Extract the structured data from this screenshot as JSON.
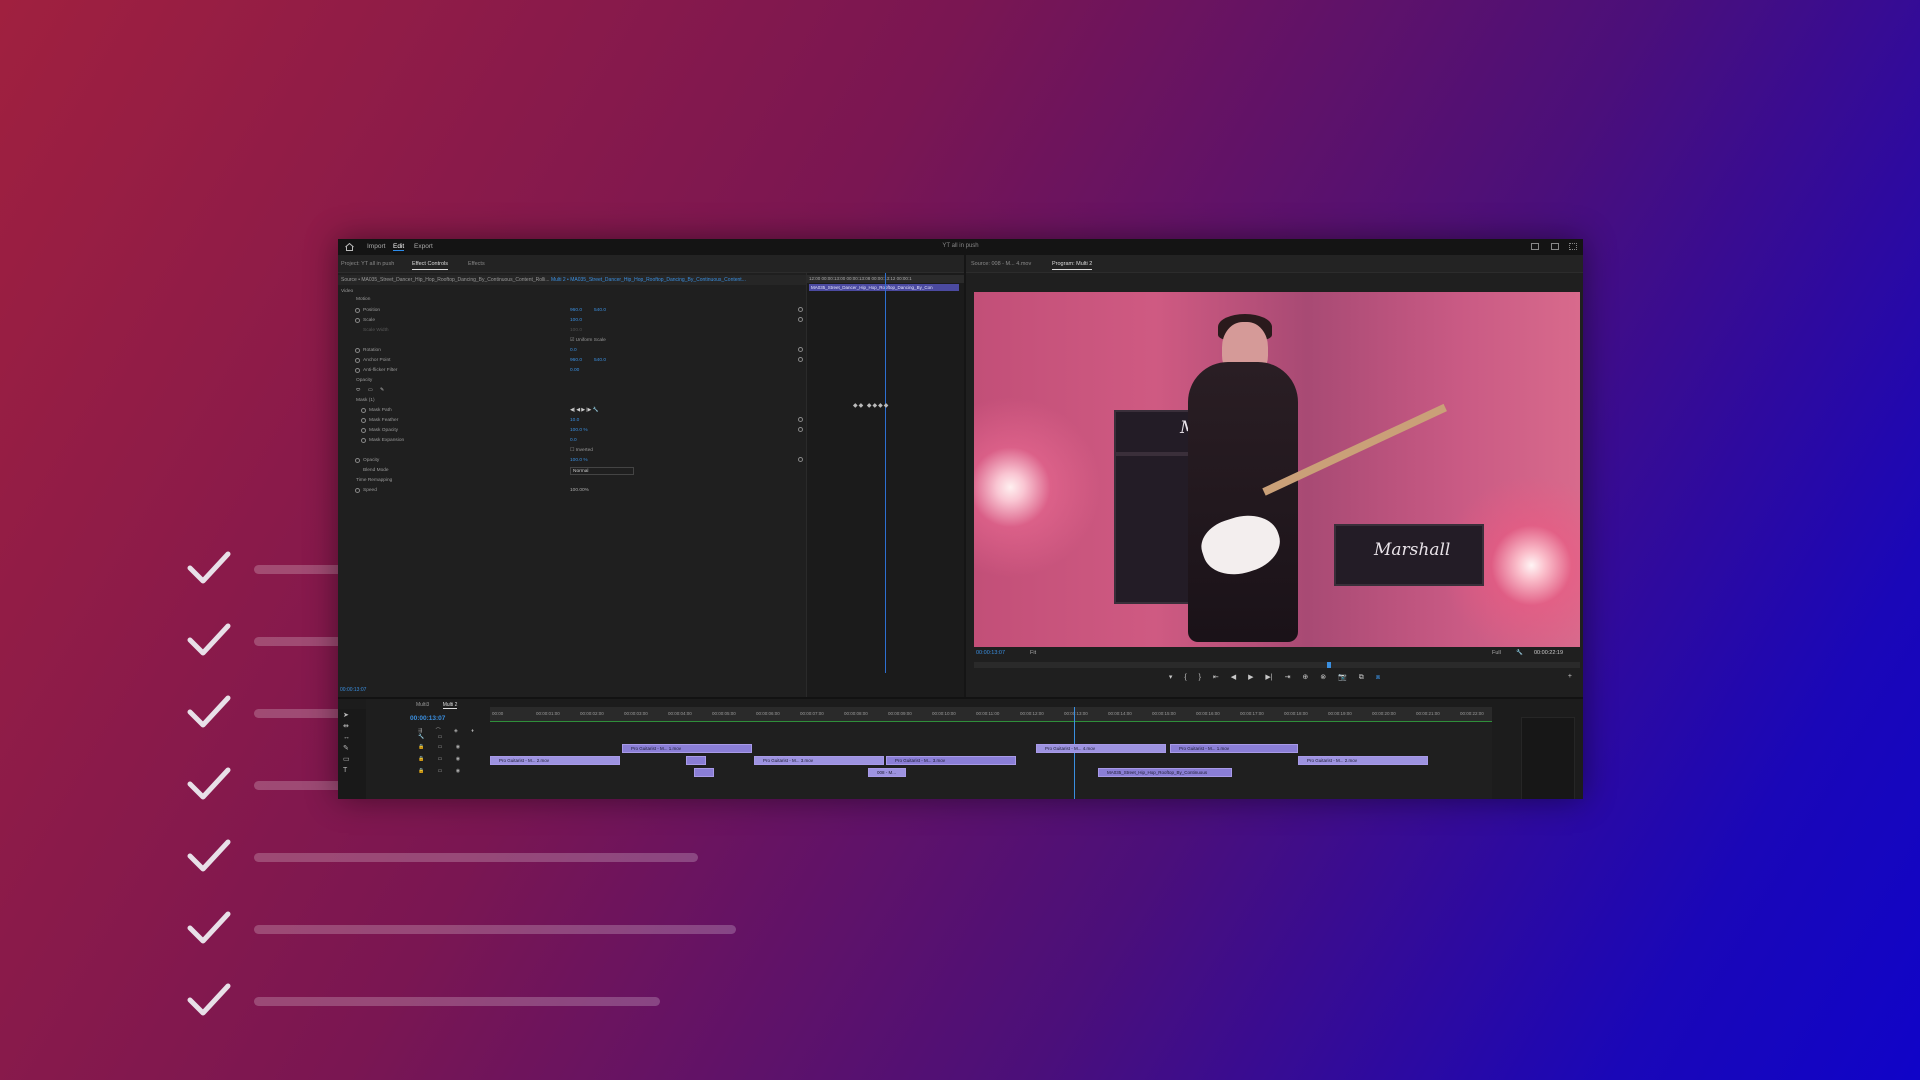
{
  "checklist": {
    "items": [
      {
        "id": "c1"
      },
      {
        "id": "c2"
      },
      {
        "id": "c3"
      },
      {
        "id": "c4"
      },
      {
        "id": "c5"
      },
      {
        "id": "c6"
      },
      {
        "id": "c7"
      }
    ],
    "colors": {
      "check": "#ffffff",
      "bar": "rgba(255,255,255,0.22)"
    }
  },
  "app": {
    "window_title": "YT all in push",
    "nav": {
      "import": "Import",
      "edit": "Edit",
      "export": "Export"
    },
    "effect_controls": {
      "project_label": "Project: YT all in push",
      "tab_effect_controls": "Effect Controls",
      "tab_effects": "Effects",
      "source_label": "Source • MA035_Street_Dancer_Hip_Hop_Rooftop_Dancing_By_Continuous_Content_Rolli...",
      "sequence_label": "Multi 2 • MA035_Street_Dancer_Hip_Hop_Rooftop_Dancing_By_Continuous_Content...",
      "video_label": "Video",
      "motion": "Motion",
      "position": "Position",
      "position_x": "960.0",
      "position_y": "540.0",
      "scale": "Scale",
      "scale_val": "100.0",
      "scale_width": "Scale Width",
      "scale_width_val": "100.0",
      "uniform_scale": "Uniform Scale",
      "rotation": "Rotation",
      "rotation_val": "0.0",
      "anchor": "Anchor Point",
      "anchor_x": "960.0",
      "anchor_y": "540.0",
      "antiflicker": "Anti-flicker Filter",
      "antiflicker_val": "0.00",
      "opacity": "Opacity",
      "mask": "Mask (1)",
      "mask_path": "Mask Path",
      "mask_feather": "Mask Feather",
      "mask_feather_val": "10.0",
      "mask_opacity": "Mask Opacity",
      "mask_opacity_val": "100.0 %",
      "mask_expansion": "Mask Expansion",
      "mask_expansion_val": "0.0",
      "inverted": "Inverted",
      "opacity2": "Opacity",
      "opacity2_val": "100.0 %",
      "blend_mode": "Blend Mode",
      "blend_mode_val": "Normal",
      "time_remap": "Time Remapping",
      "speed": "Speed",
      "speed_val": "100.00%",
      "timecode": "00:00:13:07",
      "mini_ruler": "12:00   00:00:13:00   00:00:13:08   00:00:13:12   00:00:1",
      "mini_clip": "MA035_Street_Dancer_Hip_Hop_Rooftop_Dancing_By_Con"
    },
    "program": {
      "source_tab": "Source: 008 - M... 4.mov",
      "program_tab": "Program: Multi 2",
      "timecode": "00:00:13:07",
      "fit": "Fit",
      "quality": "Full",
      "duration": "00:00:22:19",
      "amp_logo_1": "Marshall",
      "amp_logo_2": "Ma"
    },
    "timeline": {
      "tab_multi": "Multi3",
      "tab_multi2": "Multi 2",
      "timecode": "00:00:13:07",
      "ruler": [
        "00:00",
        "00:00:01:00",
        "00:00:02:00",
        "00:00:03:00",
        "00:00:04:00",
        "00:00:05:00",
        "00:00:06:00",
        "00:00:07:00",
        "00:00:08:00",
        "00:00:09:00",
        "00:00:10:00",
        "00:00:11:00",
        "00:00:12:00",
        "00:00:13:00",
        "00:00:14:00",
        "00:00:15:00",
        "00:00:16:00",
        "00:00:17:00",
        "00:00:18:00",
        "00:00:19:00",
        "00:00:20:00",
        "00:00:21:00",
        "00:00:22:00"
      ],
      "clips": [
        "Pro Guitarist - M... 2.mov",
        "Pro Guitarist - M... 1.mov",
        "Pro Guitarist - M... 3.mov",
        "Pro Guitarist - M... 3.mov",
        "Pro Guitarist - M... 2.mov",
        "Pro Guitarist - M... 2.mov",
        "Pro Guitarist - M... 4.mov",
        "Pro Guitarist - M... 1.mov",
        "008 - M...",
        "MA035_Street_Hip_Hop_Rooftop_By_Continuous"
      ]
    }
  }
}
